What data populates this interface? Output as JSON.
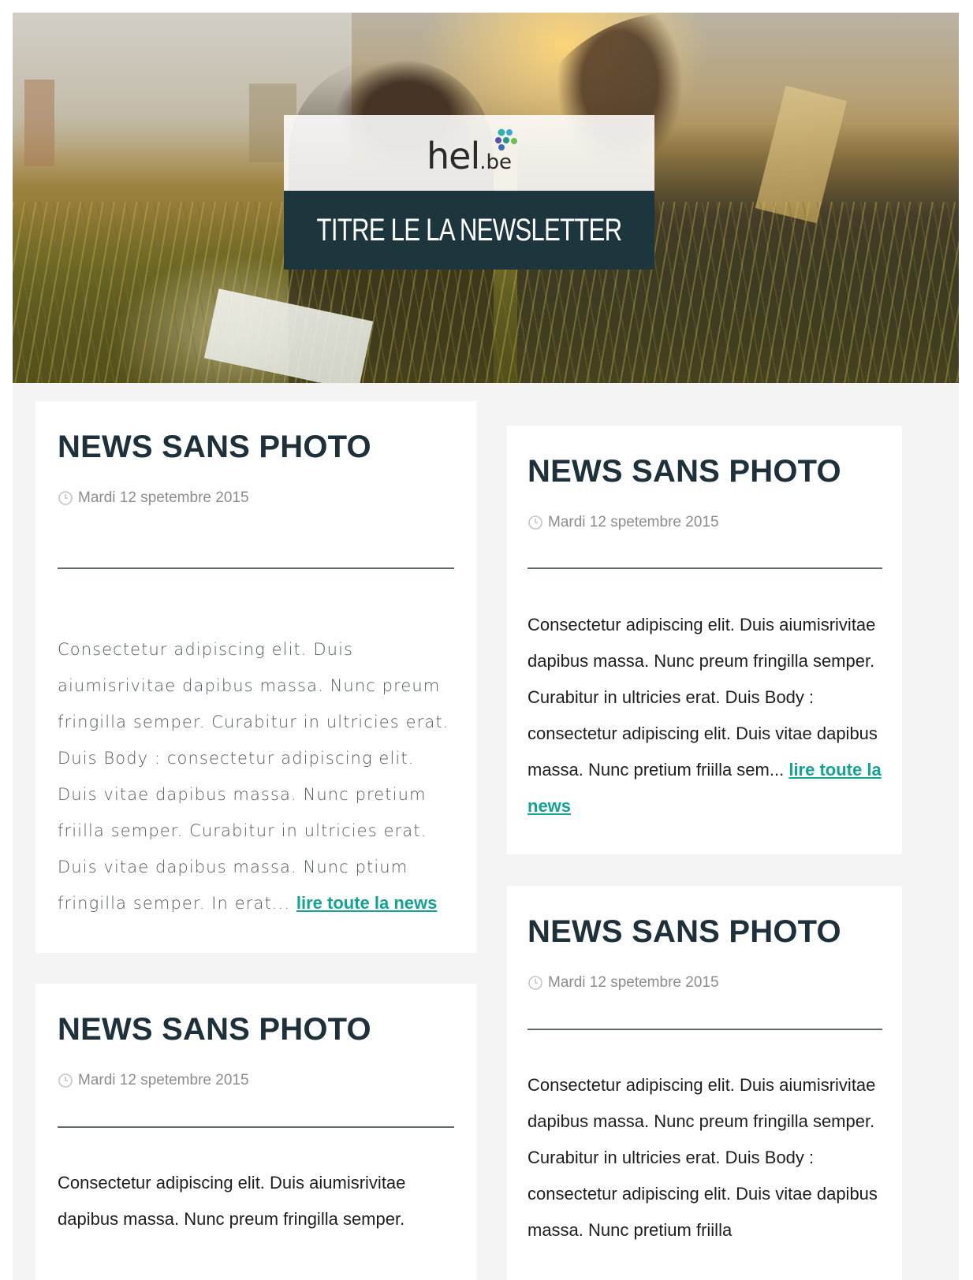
{
  "header": {
    "logo_main": "hel",
    "logo_suffix": ".be",
    "newsletter_title": "TITRE LE LA NEWSLETTER"
  },
  "colors": {
    "title_band": "#1d353d",
    "heading": "#1e3039",
    "link": "#13a392",
    "page_bg": "#f4f4f4"
  },
  "articles": [
    {
      "title": "NEWS SANS PHOTO",
      "date": "Mardi 12 spetembre 2015",
      "body": "Consectetur adipiscing elit. Duis aiumisrivitae dapibus massa. Nunc preum fringilla semper. Curabitur in ultricies erat. Duis Body : consectetur adipiscing elit. Duis vitae dapibus massa. Nunc pretium friilla semper. Curabitur in ultricies erat. Duis vitae dapibus massa. Nunc ptium fringilla semper. In erat...",
      "read_more": "lire toute la news"
    },
    {
      "title": "NEWS SANS PHOTO",
      "date": "Mardi 12 spetembre 2015",
      "body": "Consectetur adipiscing elit. Duis aiumisrivitae dapibus massa. Nunc preum fringilla semper. Curabitur in ultricies erat. Duis Body : consectetur adipiscing elit. Duis vitae dapibus massa. Nunc pretium friilla sem...",
      "read_more": "lire toute la news"
    },
    {
      "title": "NEWS SANS PHOTO",
      "date": "Mardi 12 spetembre 2015",
      "body": "Consectetur adipiscing elit. Duis aiumisrivitae dapibus massa. Nunc preum fringilla semper.",
      "read_more": ""
    },
    {
      "title": "NEWS SANS PHOTO",
      "date": "Mardi 12 spetembre 2015",
      "body": "Consectetur adipiscing elit. Duis aiumisrivitae dapibus massa. Nunc preum fringilla semper. Curabitur in ultricies erat. Duis Body : consectetur adipiscing elit. Duis vitae dapibus massa. Nunc pretium friilla",
      "read_more": ""
    }
  ]
}
